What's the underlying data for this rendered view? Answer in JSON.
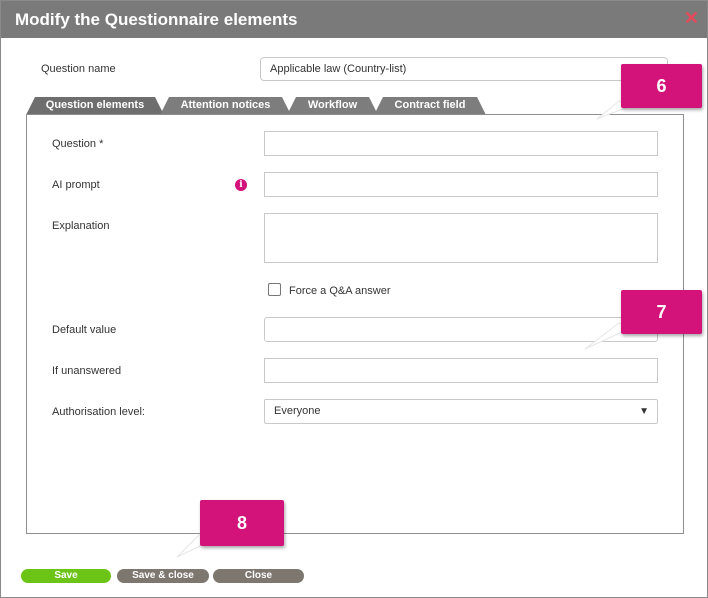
{
  "dialog": {
    "title": "Modify the Questionnaire elements",
    "close_glyph": "✕"
  },
  "question_name": {
    "label": "Question name",
    "value": "Applicable law (Country-list)"
  },
  "tabs": [
    {
      "label": "Question elements",
      "active": true
    },
    {
      "label": "Attention notices",
      "active": false
    },
    {
      "label": "Workflow",
      "active": false
    },
    {
      "label": "Contract field",
      "active": false
    }
  ],
  "form": {
    "question_label": "Question *",
    "question_value": "",
    "ai_prompt_label": "AI prompt",
    "ai_prompt_value": "",
    "info_icon_glyph": "i",
    "explanation_label": "Explanation",
    "explanation_value": "",
    "force_qa_label": "Force a Q&A answer",
    "force_qa_checked": false,
    "default_value_label": "Default value",
    "default_value_value": "",
    "if_unanswered_label": "If unanswered",
    "if_unanswered_value": "",
    "authorisation_label": "Authorisation level:",
    "authorisation_value": "Everyone",
    "select_arrow": "▼"
  },
  "callouts": [
    "6",
    "7",
    "8"
  ],
  "buttons": {
    "save": "Save",
    "save_close": "Save & close",
    "close": "Close"
  },
  "colors": {
    "titlebar": "#7a7a7a",
    "accent_pink": "#d4137a",
    "close_red": "#e8495a",
    "save_green": "#6cc417",
    "button_gray": "#7d7770"
  }
}
